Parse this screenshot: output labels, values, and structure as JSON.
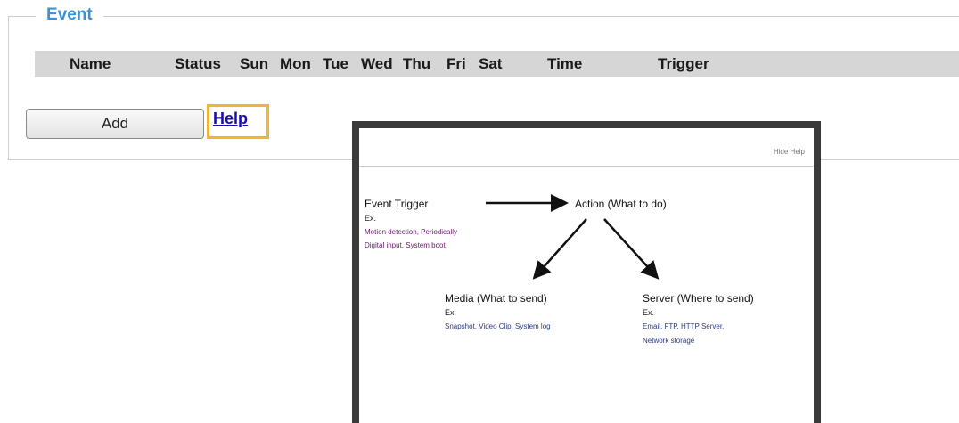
{
  "event": {
    "legend": "Event",
    "columns": [
      "Name",
      "Status",
      "Sun",
      "Mon",
      "Tue",
      "Wed",
      "Thu",
      "Fri",
      "Sat",
      "Time",
      "Trigger"
    ],
    "add_label": "Add",
    "help_label": "Help"
  },
  "help_popup": {
    "top_right": "Hide Help",
    "event_trigger": "Event Trigger",
    "action": "Action (What to do)",
    "media": "Media (What to send)",
    "server": "Server (Where to send)",
    "ex": "Ex.",
    "trigger_ex1": "Motion detection, Periodically",
    "trigger_ex2": "Digital input, System boot",
    "media_ex1": "Snapshot, Video Clip, System log",
    "server_ex1": "Email, FTP, HTTP Server,",
    "server_ex2": "Network storage"
  },
  "colors": {
    "legend": "#3d8fd6",
    "header_bar": "#d6d6d6",
    "highlight": "#f3b434",
    "link": "#1a0dab"
  }
}
